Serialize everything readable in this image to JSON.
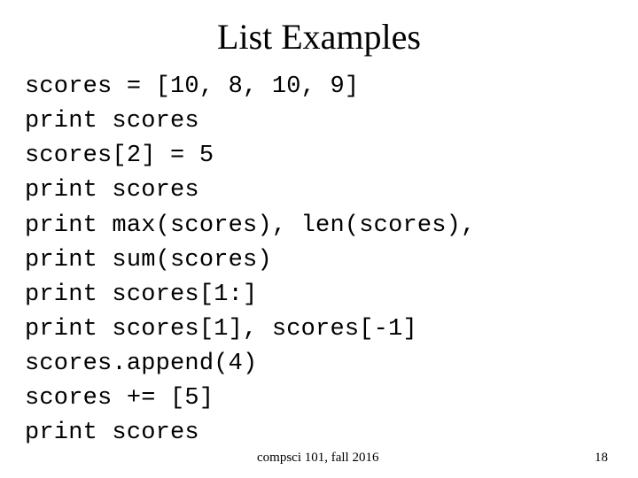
{
  "title": "List Examples",
  "code": {
    "l1": "scores = [10, 8, 10, 9]",
    "l2": "print scores",
    "l3": "scores[2] = 5",
    "l4": "print scores",
    "l5": "print max(scores), len(scores),",
    "l6": "print sum(scores)",
    "l7": "print scores[1:]",
    "l8": "print scores[1], scores[-1]",
    "l9": "scores.append(4)",
    "l10": "scores += [5]",
    "l11": "print scores"
  },
  "footer": {
    "course": "compsci 101, fall 2016",
    "page": "18"
  }
}
